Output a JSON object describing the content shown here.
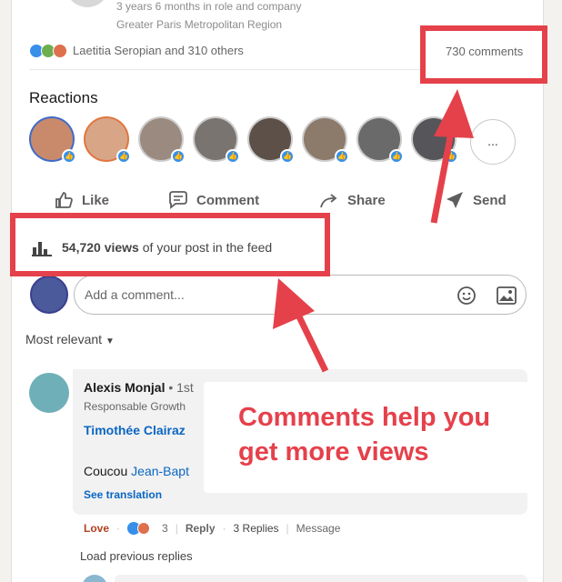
{
  "post_author": {
    "tenure": "3 years 6 months in role and company",
    "location": "Greater Paris Metropolitan Region"
  },
  "social_counts": {
    "reactions_text": "Laetitia Seropian and 310 others",
    "comments_text": "730 comments"
  },
  "reactions": {
    "heading": "Reactions",
    "more_label": "..."
  },
  "actions": {
    "like": "Like",
    "comment": "Comment",
    "share": "Share",
    "send": "Send"
  },
  "views": {
    "count": "54,720 views",
    "suffix": " of your post in the feed"
  },
  "comment_input": {
    "placeholder": "Add a comment..."
  },
  "sort": {
    "label": "Most relevant"
  },
  "top_comment": {
    "author": "Alexis Monjal",
    "degree": "• 1st",
    "headline": "Responsable Growth",
    "mention": "Timothée Clairaz",
    "body_prefix": "Coucou ",
    "body_mention": "Jean-Bapt",
    "see_translation": "See translation",
    "love_label": "Love",
    "reaction_count": "3",
    "reply_label": "Reply",
    "replies_label": "3 Replies",
    "message_label": "Message",
    "load_previous": "Load previous replies"
  },
  "annotation": {
    "line1": "Comments help you",
    "line2": "get more views"
  },
  "colors": {
    "accent_red": "#e5414b",
    "link_blue": "#0a66c2",
    "love_red": "#b24020",
    "like_blue": "#378fe9"
  }
}
